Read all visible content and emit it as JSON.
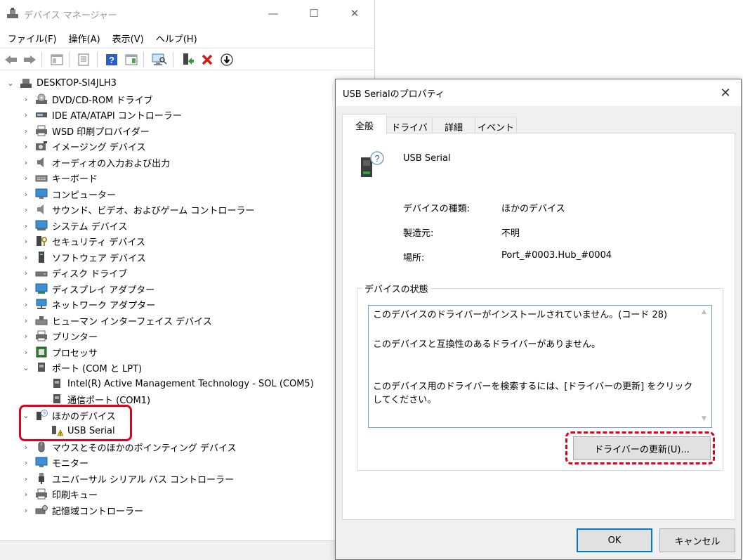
{
  "device_manager": {
    "title": "デバイス マネージャー",
    "caption_buttons": {
      "minimize": "—",
      "maximize": "☐",
      "close": "✕"
    },
    "menu": [
      "ファイル(F)",
      "操作(A)",
      "表示(V)",
      "ヘルプ(H)"
    ],
    "toolbar": [
      "back-icon",
      "forward-icon",
      "console-tree-icon",
      "properties-icon",
      "help-icon",
      "action-pane-icon",
      "scan-hardware-icon",
      "update-driver-icon",
      "uninstall-icon",
      "disable-icon"
    ],
    "root": "DESKTOP-SI4JLH3",
    "categories": [
      "DVD/CD-ROM ドライブ",
      "IDE ATA/ATAPI コントローラー",
      "WSD 印刷プロバイダー",
      "イメージング デバイス",
      "オーディオの入力および出力",
      "キーボード",
      "コンピューター",
      "サウンド、ビデオ、およびゲーム コントローラー",
      "システム デバイス",
      "セキュリティ デバイス",
      "ソフトウェア デバイス",
      "ディスク ドライブ",
      "ディスプレイ アダプター",
      "ネットワーク アダプター",
      "ヒューマン インターフェイス デバイス",
      "プリンター",
      "プロセッサ",
      "ポート (COM と LPT)"
    ],
    "ports_children": [
      "Intel(R) Active Management Technology - SOL (COM5)",
      "通信ポート (COM1)"
    ],
    "other_devices": "ほかのデバイス",
    "other_devices_children": [
      "USB Serial"
    ],
    "categories_after": [
      "マウスとそのほかのポインティング デバイス",
      "モニター",
      "ユニバーサル シリアル バス コントローラー",
      "印刷キュー",
      "記憶域コントローラー"
    ]
  },
  "dialog": {
    "title": "USB Serialのプロパティ",
    "close": "✕",
    "tabs": [
      "全般",
      "ドライバー",
      "詳細",
      "イベント"
    ],
    "device_name": "USB Serial",
    "properties": [
      {
        "label": "デバイスの種類:",
        "value": "ほかのデバイス"
      },
      {
        "label": "製造元:",
        "value": "不明"
      },
      {
        "label": "場所:",
        "value": "Port_#0003.Hub_#0004"
      }
    ],
    "status_group_label": "デバイスの状態",
    "status_lines": [
      "このデバイスのドライバーがインストールされていません。(コード 28)",
      "このデバイスと互換性のあるドライバーがありません。",
      "このデバイス用のドライバーを検索するには、[ドライバーの更新] をクリックしてください。"
    ],
    "update_button": "ドライバーの更新(U)...",
    "ok_button": "OK",
    "cancel_button": "キャンセル"
  },
  "colors": {
    "highlight_red": "#e2001a",
    "focus_blue": "#0078d7"
  }
}
